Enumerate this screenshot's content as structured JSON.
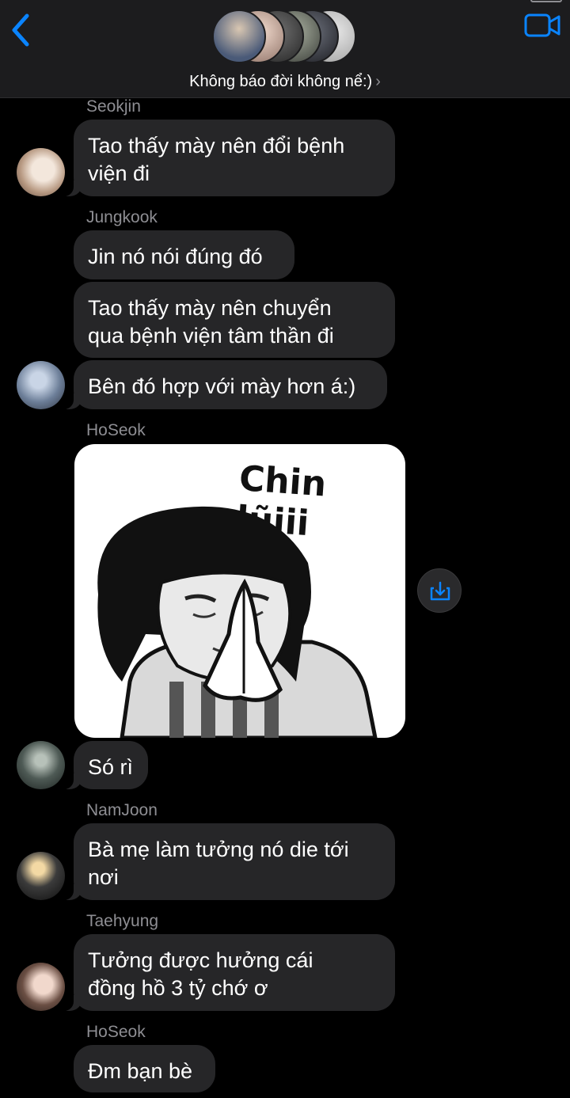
{
  "header": {
    "group_name": "Không báo đời không nể:)",
    "chevron": "›",
    "back_icon": "chevron-left-icon",
    "video_icon": "video-camera-icon",
    "accent_color": "#0a84ff",
    "member_avatars": [
      "avatar-1",
      "avatar-2",
      "avatar-3",
      "avatar-4",
      "avatar-5",
      "avatar-6"
    ]
  },
  "messages": [
    {
      "sender": "Seokjin",
      "text_lines": [
        "Tao thấy mày nên đổi bệnh",
        "viện đi"
      ]
    },
    {
      "sender": "Jungkook",
      "texts": [
        [
          "Jin nó nói đúng đó"
        ],
        [
          "Tao thấy mày nên chuyển",
          "qua bệnh viện tâm thần đi"
        ],
        [
          "Bên đó hợp với mày hơn á:)"
        ]
      ]
    },
    {
      "sender": "HoSeok",
      "sticker_text": "Chin lũiii",
      "after_text": "Só rì",
      "save_icon": "download-icon"
    },
    {
      "sender": "NamJoon",
      "text_lines": [
        "Bà mẹ làm tưởng nó die tới",
        "nơi"
      ]
    },
    {
      "sender": "Taehyung",
      "text_lines": [
        "Tưởng được hưởng cái",
        "đồng hồ 3 tỷ chớ ơ"
      ]
    },
    {
      "sender": "HoSeok",
      "text_lines": [
        "Đm bạn bè"
      ]
    }
  ]
}
